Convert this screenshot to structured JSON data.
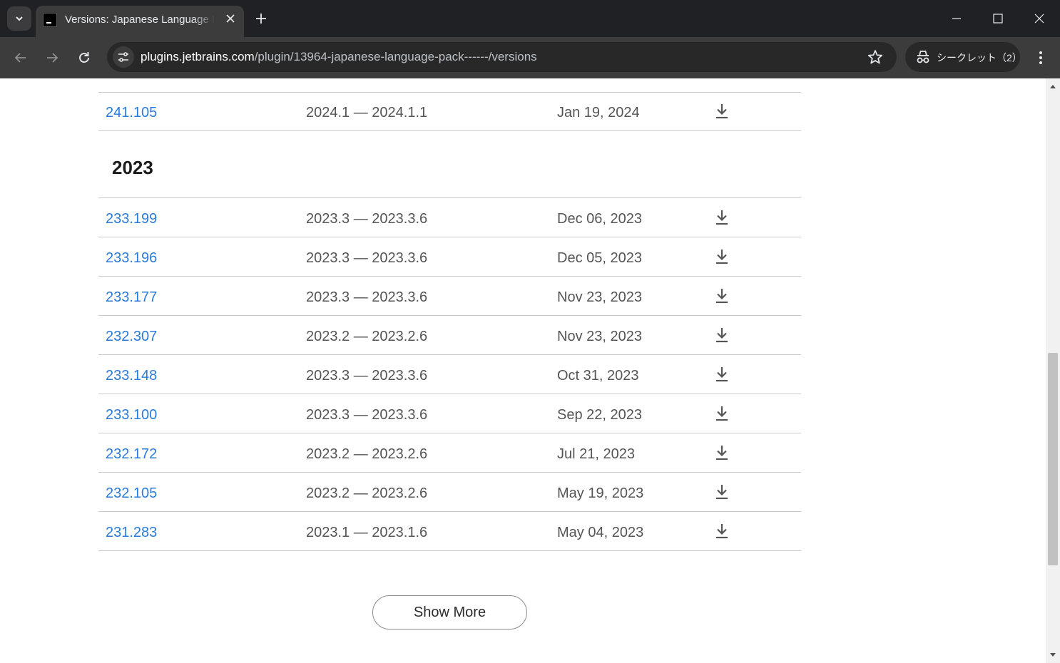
{
  "browser": {
    "tab_title": "Versions: Japanese Language Pack",
    "url_host": "plugins.jetbrains.com",
    "url_path": "/plugin/13964-japanese-language-pack------/versions",
    "incognito_label": "シークレット（2）"
  },
  "versions_top": [
    {
      "version": "241.105",
      "compat": "2024.1 — 2024.1.1",
      "date": "Jan 19, 2024"
    }
  ],
  "year_heading": "2023",
  "versions_2023": [
    {
      "version": "233.199",
      "compat": "2023.3 — 2023.3.6",
      "date": "Dec 06, 2023"
    },
    {
      "version": "233.196",
      "compat": "2023.3 — 2023.3.6",
      "date": "Dec 05, 2023"
    },
    {
      "version": "233.177",
      "compat": "2023.3 — 2023.3.6",
      "date": "Nov 23, 2023"
    },
    {
      "version": "232.307",
      "compat": "2023.2 — 2023.2.6",
      "date": "Nov 23, 2023"
    },
    {
      "version": "233.148",
      "compat": "2023.3 — 2023.3.6",
      "date": "Oct 31, 2023"
    },
    {
      "version": "233.100",
      "compat": "2023.3 — 2023.3.6",
      "date": "Sep 22, 2023"
    },
    {
      "version": "232.172",
      "compat": "2023.2 — 2023.2.6",
      "date": "Jul 21, 2023"
    },
    {
      "version": "232.105",
      "compat": "2023.2 — 2023.2.6",
      "date": "May 19, 2023"
    },
    {
      "version": "231.283",
      "compat": "2023.1 — 2023.1.6",
      "date": "May 04, 2023"
    }
  ],
  "show_more_label": "Show More",
  "icons": {
    "download": "download-icon",
    "back": "arrow-left-icon",
    "forward": "arrow-right-icon",
    "reload": "reload-icon",
    "star": "star-icon",
    "incognito": "incognito-icon",
    "menu": "kebab-menu-icon"
  },
  "colors": {
    "link": "#2a7bd9",
    "chrome_dark": "#202124",
    "toolbar": "#3c3c3c"
  }
}
